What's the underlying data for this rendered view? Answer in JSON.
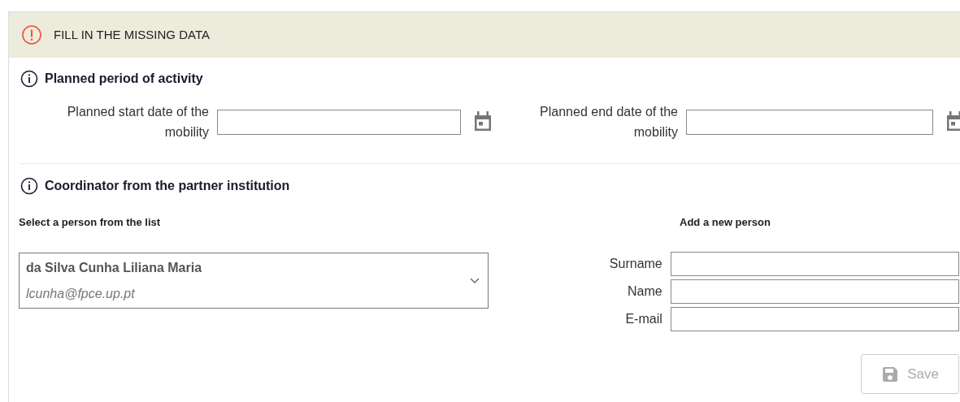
{
  "alert": {
    "text": "FILL IN THE MISSING DATA"
  },
  "period": {
    "title": "Planned period of activity",
    "fields": [
      {
        "label": "Planned start date of the mobility"
      },
      {
        "label": "Planned end date of the mobility"
      }
    ]
  },
  "coordinator": {
    "title": "Coordinator from the partner institution",
    "select_label": "Select a person from the list",
    "selected_person": {
      "name": "da Silva Cunha Liliana Maria",
      "email": "lcunha@fpce.up.pt"
    },
    "add_label": "Add a new person",
    "new_person_fields": [
      {
        "label": "Surname"
      },
      {
        "label": "Name"
      },
      {
        "label": "E-mail"
      }
    ],
    "save_button": {
      "label": "Save",
      "disabled": true
    }
  }
}
